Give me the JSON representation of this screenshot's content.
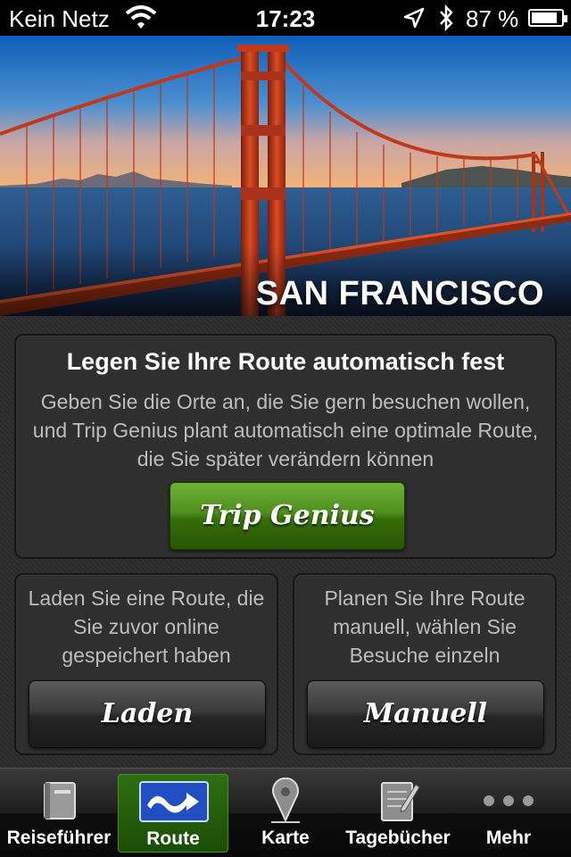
{
  "status_bar": {
    "carrier": "Kein Netz",
    "time": "17:23",
    "battery_percent": "87 %",
    "battery_level": 0.87
  },
  "hero": {
    "city": "SAN FRANCISCO"
  },
  "auto_route": {
    "title": "Legen Sie Ihre Route automatisch fest",
    "description": "Geben Sie die Orte an, die Sie gern besuchen wollen, und Trip Genius plant automatisch eine optimale Route, die Sie später verändern können",
    "button_label": "Trip Genius"
  },
  "load_route": {
    "description": "Laden Sie eine Route, die Sie zuvor online gespeichert haben",
    "button_label": "Laden"
  },
  "manual_route": {
    "description": "Planen Sie Ihre Route manuell, wählen Sie Besuche einzeln",
    "button_label": "Manuell"
  },
  "tabs": [
    {
      "label": "Reiseführer",
      "icon": "guidebook-icon",
      "active": false
    },
    {
      "label": "Route",
      "icon": "route-icon",
      "active": true
    },
    {
      "label": "Karte",
      "icon": "map-pin-icon",
      "active": false
    },
    {
      "label": "Tagebücher",
      "icon": "journal-icon",
      "active": false
    },
    {
      "label": "Mehr",
      "icon": "more-icon",
      "active": false
    }
  ],
  "colors": {
    "accent_green": "#4e8e1e",
    "active_tab_blue": "#1f4fc2",
    "bridge_red": "#c0391b"
  }
}
